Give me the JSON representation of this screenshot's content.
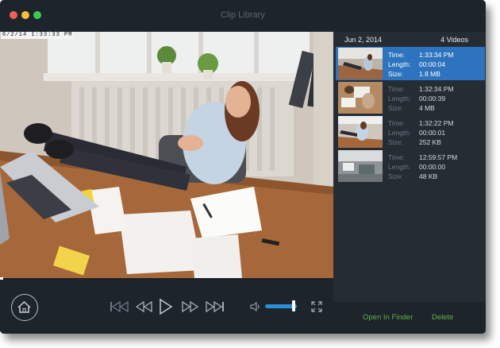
{
  "window": {
    "title": "Clip Library"
  },
  "video": {
    "timestamp_overlay": "6/2/14  1:33:33 PM"
  },
  "sidebar": {
    "date": "Jun 2, 2014",
    "video_count": "4 Videos",
    "clips": [
      {
        "time_label": "Time:",
        "time": "1:33:34 PM",
        "length_label": "Length:",
        "length": "00:00:04",
        "size_label": "Size:",
        "size": "1.8 MB",
        "selected": true
      },
      {
        "time_label": "Time:",
        "time": "1:32:34 PM",
        "length_label": "Length:",
        "length": "00:00:39",
        "size_label": "Size:",
        "size": "4 MB",
        "selected": false
      },
      {
        "time_label": "Time:",
        "time": "1:32:22 PM",
        "length_label": "Length:",
        "length": "00:00:01",
        "size_label": "Size:",
        "size": "252 KB",
        "selected": false
      },
      {
        "time_label": "Time:",
        "time": "12:59:57 PM",
        "length_label": "Length:",
        "length": "00:00:00",
        "size_label": "Size:",
        "size": "48 KB",
        "selected": false
      }
    ],
    "footer": {
      "open_label": "Open In Finder",
      "delete_label": "Delete"
    }
  },
  "controls": {
    "icons": [
      "home-icon",
      "skip-to-start-icon",
      "rewind-icon",
      "play-icon",
      "fast-forward-icon",
      "skip-to-end-icon",
      "volume-icon",
      "fullscreen-icon"
    ],
    "volume_level": 0.85
  },
  "colors": {
    "accent_blue": "#2d73bd",
    "action_green": "#58b545",
    "background": "#1b2128"
  }
}
